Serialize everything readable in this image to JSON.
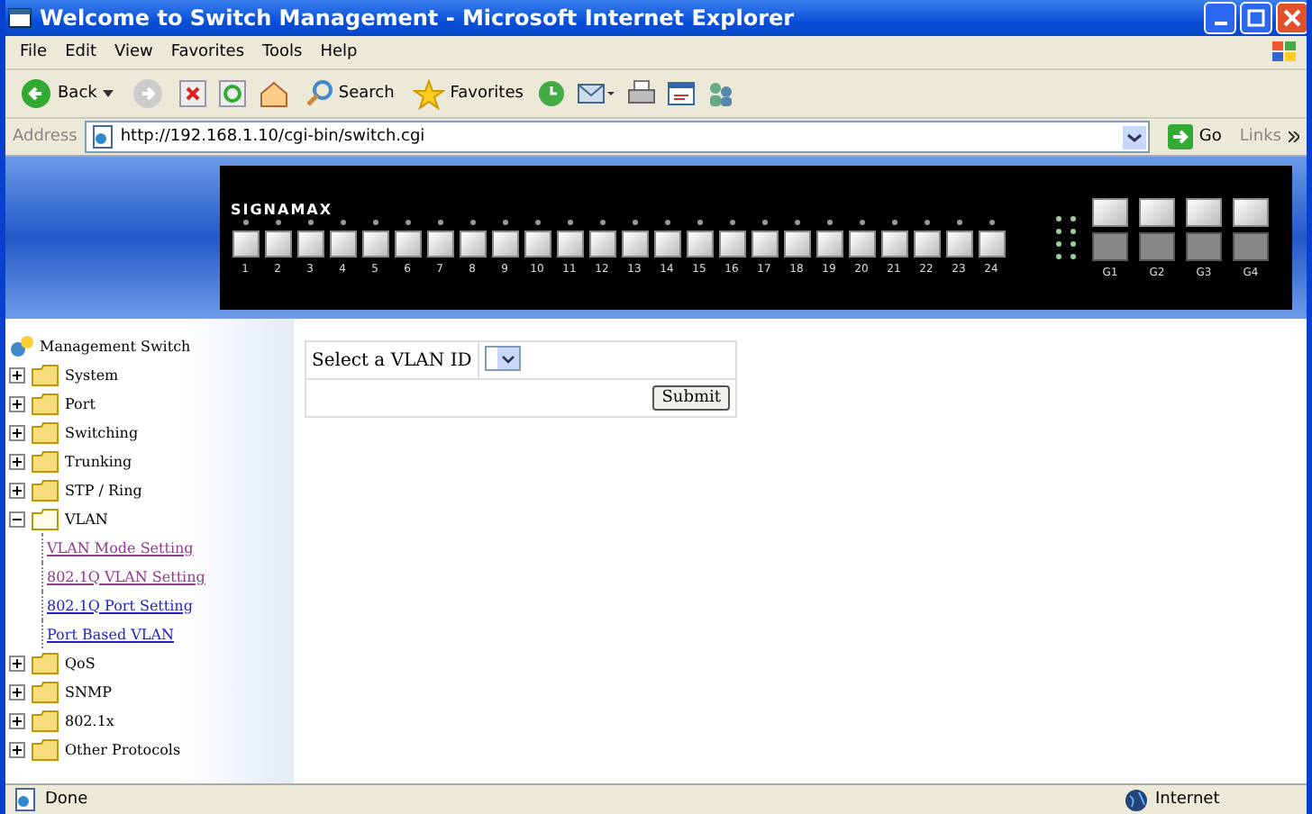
{
  "window": {
    "title": "Welcome to Switch Management - Microsoft Internet Explorer"
  },
  "menu": [
    "File",
    "Edit",
    "View",
    "Favorites",
    "Tools",
    "Help"
  ],
  "toolbar": {
    "back": "Back",
    "search": "Search",
    "favorites": "Favorites"
  },
  "address": {
    "label": "Address",
    "url": "http://192.168.1.10/cgi-bin/switch.cgi",
    "go": "Go",
    "links": "Links"
  },
  "switch_panel": {
    "logo": "SIGNAMAX",
    "ports": [
      "1",
      "2",
      "3",
      "4",
      "5",
      "6",
      "7",
      "8",
      "9",
      "10",
      "11",
      "12",
      "13",
      "14",
      "15",
      "16",
      "17",
      "18",
      "19",
      "20",
      "21",
      "22",
      "23",
      "24"
    ],
    "uplinks": [
      "G1",
      "G2",
      "G3",
      "G4"
    ]
  },
  "sidebar": {
    "root": "Management Switch",
    "items": [
      {
        "label": "System",
        "expanded": false
      },
      {
        "label": "Port",
        "expanded": false
      },
      {
        "label": "Switching",
        "expanded": false
      },
      {
        "label": "Trunking",
        "expanded": false
      },
      {
        "label": "STP / Ring",
        "expanded": false
      },
      {
        "label": "VLAN",
        "expanded": true,
        "children": [
          {
            "label": "VLAN Mode Setting",
            "visited": true
          },
          {
            "label": "802.1Q VLAN Setting",
            "visited": true
          },
          {
            "label": "802.1Q Port Setting",
            "visited": false
          },
          {
            "label": "Port Based VLAN",
            "visited": false
          }
        ]
      },
      {
        "label": "QoS",
        "expanded": false
      },
      {
        "label": "SNMP",
        "expanded": false
      },
      {
        "label": "802.1x",
        "expanded": false
      },
      {
        "label": "Other Protocols",
        "expanded": false
      }
    ]
  },
  "form": {
    "label": "Select a VLAN ID",
    "submit": "Submit"
  },
  "status_bar": {
    "text": "Done",
    "zone": "Internet"
  }
}
